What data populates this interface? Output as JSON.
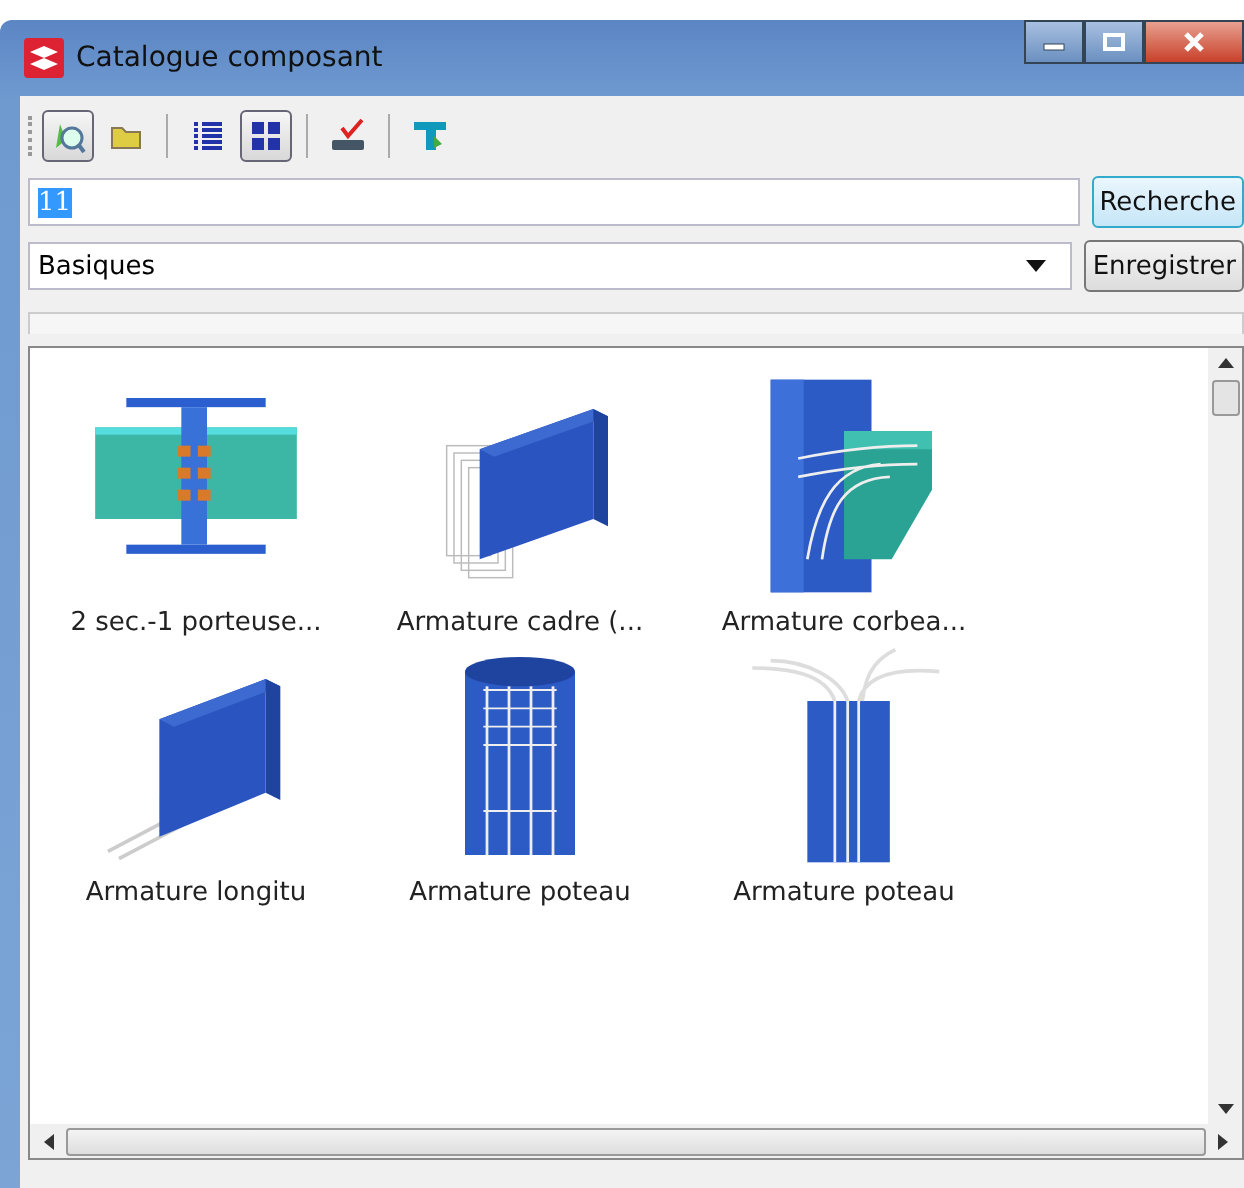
{
  "window": {
    "title": "Catalogue composant"
  },
  "toolbar": [
    {
      "kind": "search",
      "selected": true
    },
    {
      "kind": "folder",
      "selected": false
    },
    {
      "kind": "separator"
    },
    {
      "kind": "list",
      "selected": false
    },
    {
      "kind": "grid",
      "selected": true
    },
    {
      "kind": "separator"
    },
    {
      "kind": "spell"
    },
    {
      "kind": "separator"
    },
    {
      "kind": "beam"
    }
  ],
  "search": {
    "value": "11",
    "button": "Recherche"
  },
  "category": {
    "value": "Basiques",
    "button": "Enregistrer"
  },
  "items": [
    {
      "label": "2 sec.-1 porteuse...",
      "kind": "beam-joint"
    },
    {
      "label": "Armature cadre (...",
      "kind": "box-cage"
    },
    {
      "label": "Armature corbea...",
      "kind": "corbel"
    },
    {
      "label": "Armature longitu",
      "kind": "box-bars"
    },
    {
      "label": "Armature poteau",
      "kind": "cylinder-cage"
    },
    {
      "label": "Armature poteau",
      "kind": "column-bars"
    }
  ]
}
